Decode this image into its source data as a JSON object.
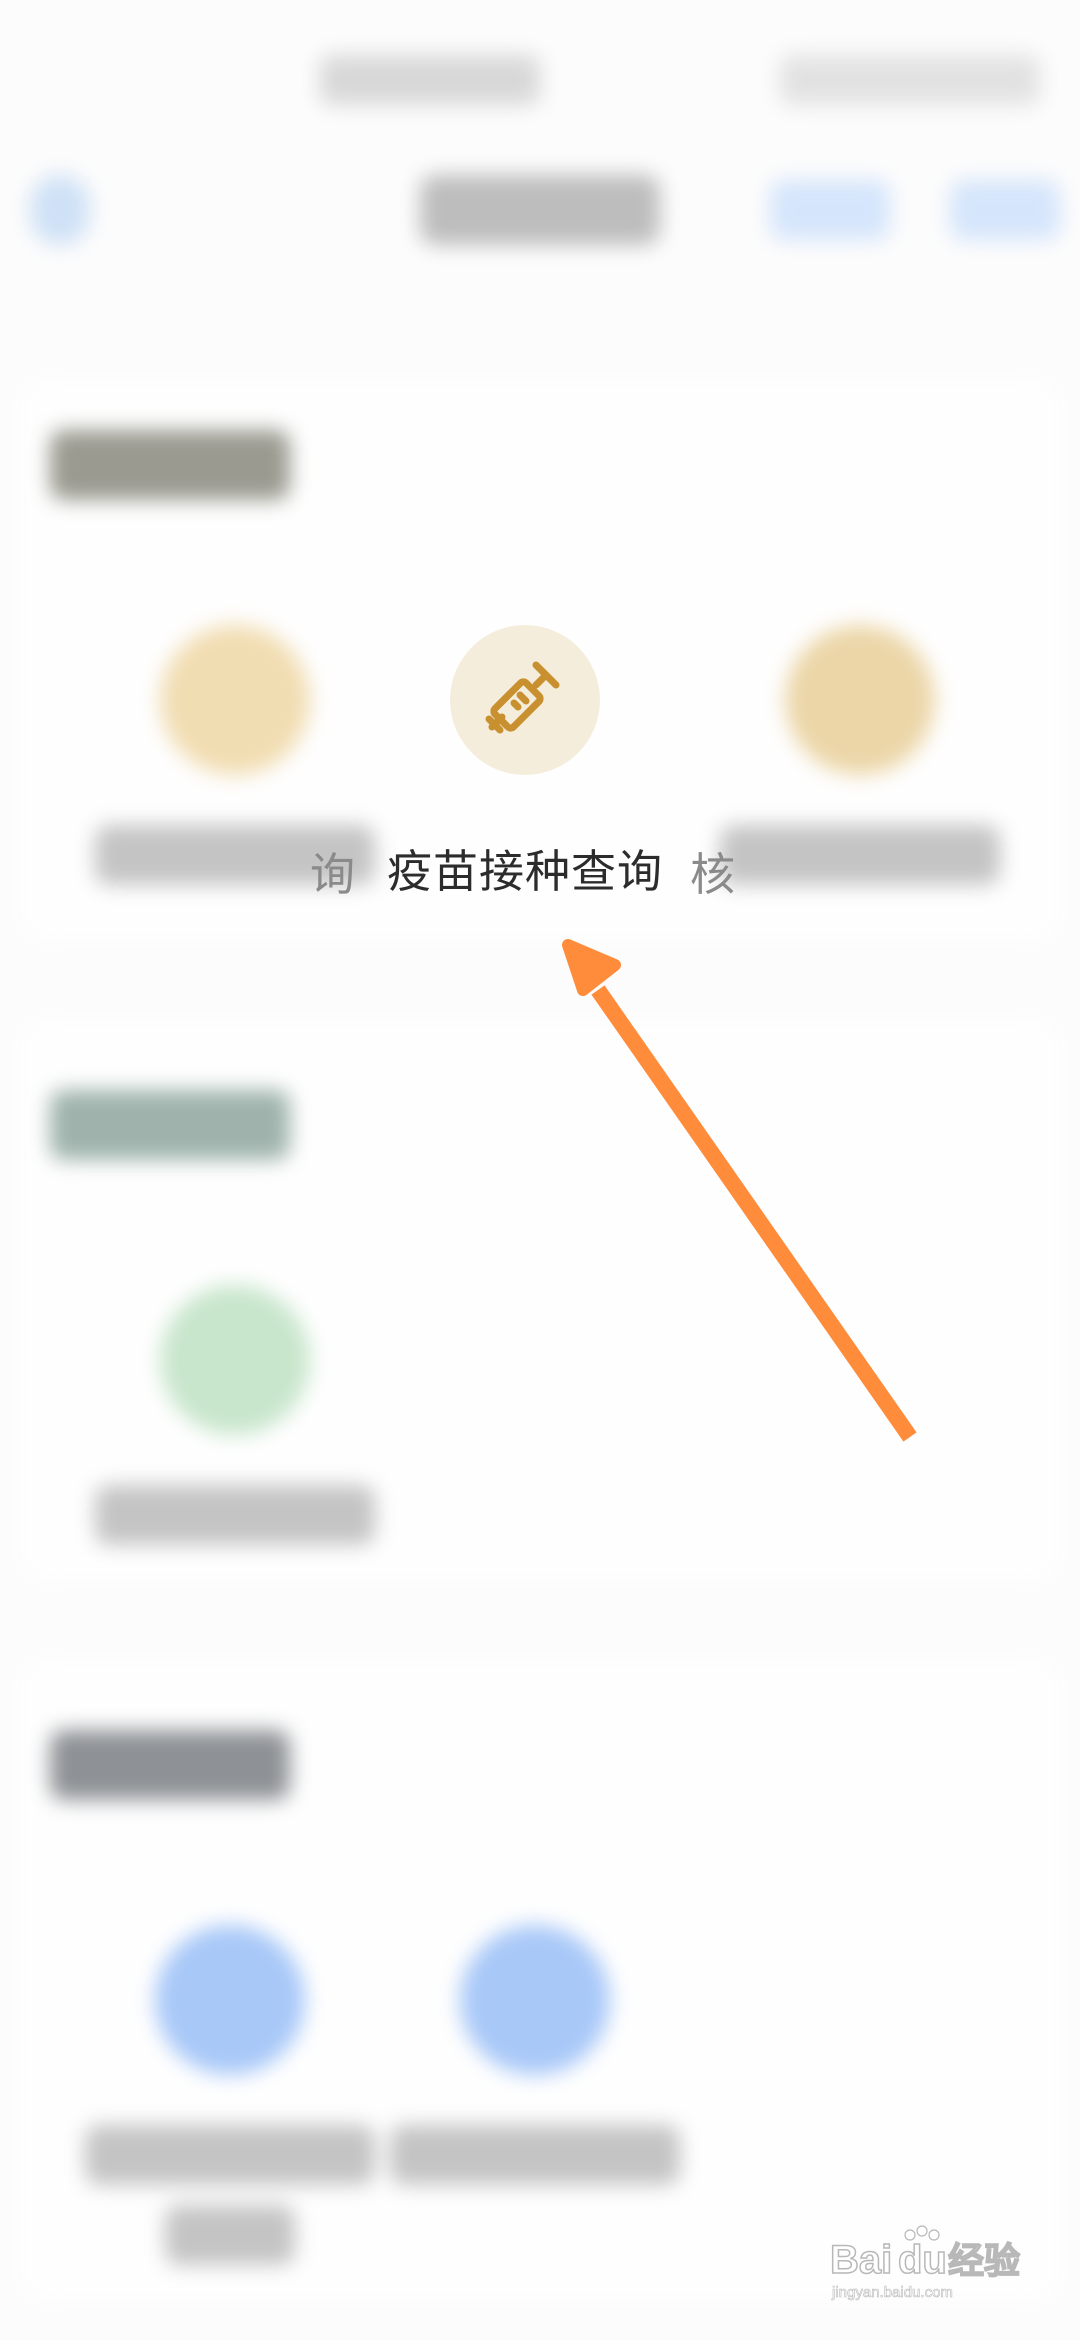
{
  "focused_service": {
    "label": "疫苗接种查询",
    "icon": "syringe-icon"
  },
  "neighbor_services": {
    "left_partial_text": "询",
    "right_partial_text": "核"
  },
  "annotation": {
    "arrow_color": "#ff8c3a"
  },
  "watermark": {
    "brand": "Bai",
    "brand_paw": "du",
    "suffix": "经验",
    "url": "jingyan.baidu.com"
  },
  "colors": {
    "icon_gold": "#c8902f",
    "icon_bg": "#f5eddc",
    "green_icon": "#c8e6cc",
    "blue_icon": "#a8c8f8"
  }
}
